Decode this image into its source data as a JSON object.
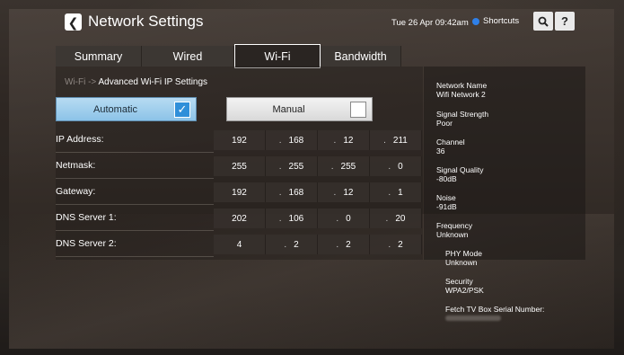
{
  "header": {
    "back_icon": "chevron-left-icon",
    "title": "Network Settings",
    "datetime": "Tue 26 Apr 09:42am",
    "shortcuts_label": "Shortcuts",
    "shortcuts_dot_color": "#2f80e8",
    "search_icon": "search-icon",
    "help_label": "?"
  },
  "tabs": [
    {
      "label": "Summary",
      "active": false
    },
    {
      "label": "Wired",
      "active": false
    },
    {
      "label": "Wi-Fi",
      "active": true
    },
    {
      "label": "Bandwidth",
      "active": false
    }
  ],
  "breadcrumb": {
    "parent": "Wi-Fi ->",
    "current": "Advanced Wi-Fi IP Settings"
  },
  "mode": {
    "automatic_label": "Automatic",
    "automatic_checked": true,
    "manual_label": "Manual",
    "manual_checked": false
  },
  "fields": [
    {
      "label": "IP Address:",
      "octets": [
        "192",
        "168",
        "12",
        "211"
      ]
    },
    {
      "label": "Netmask:",
      "octets": [
        "255",
        "255",
        "255",
        "0"
      ]
    },
    {
      "label": "Gateway:",
      "octets": [
        "192",
        "168",
        "12",
        "1"
      ]
    },
    {
      "label": "DNS Server 1:",
      "octets": [
        "202",
        "106",
        "0",
        "20"
      ]
    },
    {
      "label": "DNS Server 2:",
      "octets": [
        "4",
        "2",
        "2",
        "2"
      ]
    }
  ],
  "octet_separator": ".",
  "info": {
    "network_name_label": "Network Name",
    "network_name_value": "Wifi Network 2",
    "signal_strength_label": "Signal Strength",
    "signal_strength_value": "Poor",
    "channel_label": "Channel",
    "channel_value": "36",
    "signal_quality_label": "Signal Quality",
    "signal_quality_value": "-80dB",
    "noise_label": "Noise",
    "noise_value": "-91dB",
    "frequency_label": "Frequency",
    "frequency_value": "Unknown",
    "phy_mode_label": "PHY Mode",
    "phy_mode_value": "Unknown",
    "security_label": "Security",
    "security_value": "WPA2/PSK",
    "serial_label": "Fetch TV Box Serial Number:"
  },
  "colors": {
    "automatic_button": "#8cc3e8",
    "checkbox_checked": "#2f8fd9",
    "manual_button": "#e6e6e6"
  }
}
